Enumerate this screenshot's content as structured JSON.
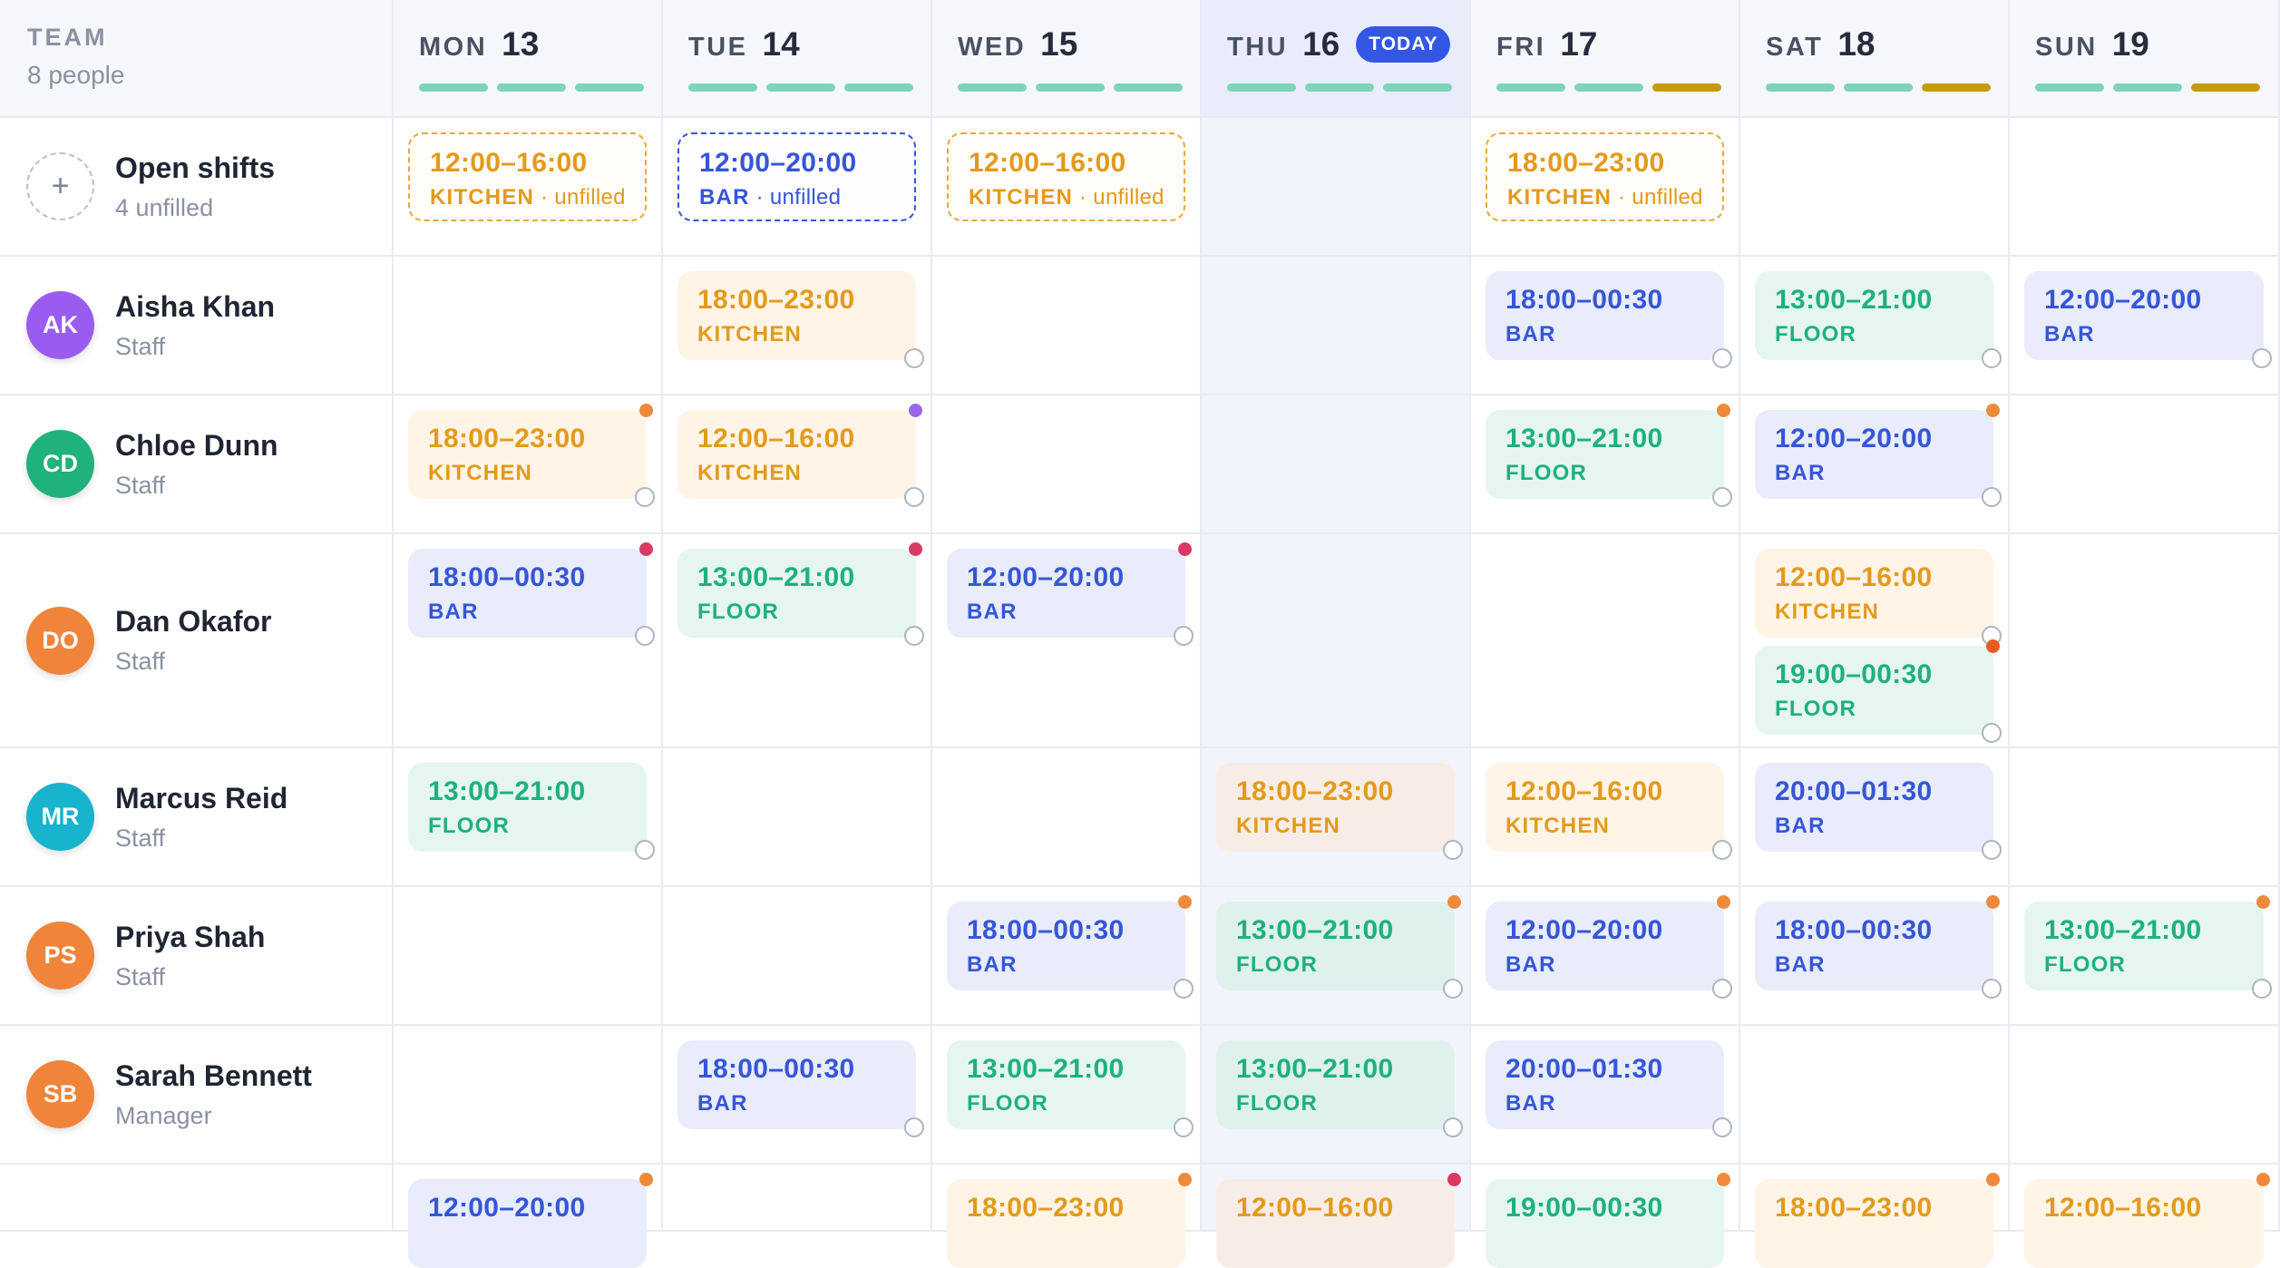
{
  "team": {
    "title": "TEAM",
    "count": "8 people"
  },
  "colors": {
    "kitchen": "#e39a1c",
    "bar": "#3656d6",
    "floor": "#1fb07f",
    "accent": "#3457e3",
    "coverage_ok": "#7fd4b8",
    "coverage_partial": "#c69a0f"
  },
  "days": [
    {
      "dow": "MON",
      "num": "13",
      "coverage": [
        "ok",
        "ok",
        "ok"
      ]
    },
    {
      "dow": "TUE",
      "num": "14",
      "coverage": [
        "ok",
        "ok",
        "ok"
      ]
    },
    {
      "dow": "WED",
      "num": "15",
      "coverage": [
        "ok",
        "ok",
        "ok"
      ]
    },
    {
      "dow": "THU",
      "num": "16",
      "coverage": [
        "ok",
        "ok",
        "ok"
      ],
      "today_label": "TODAY"
    },
    {
      "dow": "FRI",
      "num": "17",
      "coverage": [
        "ok",
        "ok",
        "partial"
      ]
    },
    {
      "dow": "SAT",
      "num": "18",
      "coverage": [
        "ok",
        "ok",
        "partial"
      ]
    },
    {
      "dow": "SUN",
      "num": "19",
      "coverage": [
        "ok",
        "ok",
        "partial"
      ]
    }
  ],
  "rows": [
    {
      "name": "Open shifts",
      "role": "4 unfilled",
      "avatar": "+",
      "open": true,
      "shifts": [
        [
          {
            "time": "12:00–16:00",
            "area": "KITCHEN",
            "sub": " · unfilled",
            "type": "open-kitchen"
          }
        ],
        [
          {
            "time": "12:00–20:00",
            "area": "BAR",
            "sub": " · unfilled",
            "type": "open-bar"
          }
        ],
        [
          {
            "time": "12:00–16:00",
            "area": "KITCHEN",
            "sub": " · unfilled",
            "type": "open-kitchen"
          }
        ],
        [],
        [
          {
            "time": "18:00–23:00",
            "area": "KITCHEN",
            "sub": " · unfilled",
            "type": "open-kitchen"
          }
        ],
        [],
        []
      ]
    },
    {
      "name": "Aisha Khan",
      "role": "Staff",
      "avatar": "AK",
      "avatar_color": "#9a5cf0",
      "shifts": [
        [],
        [
          {
            "time": "18:00–23:00",
            "area": "KITCHEN",
            "type": "kitchen",
            "ring": true
          }
        ],
        [],
        [],
        [
          {
            "time": "18:00–00:30",
            "area": "BAR",
            "type": "bar",
            "ring": true
          }
        ],
        [
          {
            "time": "13:00–21:00",
            "area": "FLOOR",
            "type": "floor",
            "ring": true
          }
        ],
        [
          {
            "time": "12:00–20:00",
            "area": "BAR",
            "type": "bar",
            "ring": true
          }
        ]
      ]
    },
    {
      "name": "Chloe Dunn",
      "role": "Staff",
      "avatar": "CD",
      "avatar_color": "#1fb27a",
      "shifts": [
        [
          {
            "time": "18:00–23:00",
            "area": "KITCHEN",
            "type": "kitchen",
            "ring": true,
            "flag": "#ef8a3c"
          }
        ],
        [
          {
            "time": "12:00–16:00",
            "area": "KITCHEN",
            "type": "kitchen",
            "ring": true,
            "flag": "#9a66e8"
          }
        ],
        [],
        [],
        [
          {
            "time": "13:00–21:00",
            "area": "FLOOR",
            "type": "floor",
            "ring": true,
            "flag": "#ef8a3c"
          }
        ],
        [
          {
            "time": "12:00–20:00",
            "area": "BAR",
            "type": "bar",
            "ring": true,
            "flag": "#ef8a3c"
          }
        ],
        []
      ]
    },
    {
      "name": "Dan Okafor",
      "role": "Staff",
      "avatar": "DO",
      "avatar_color": "#f0843a",
      "shifts": [
        [
          {
            "time": "18:00–00:30",
            "area": "BAR",
            "type": "bar",
            "ring": true,
            "flag": "#d93a63"
          }
        ],
        [
          {
            "time": "13:00–21:00",
            "area": "FLOOR",
            "type": "floor",
            "ring": true,
            "flag": "#d93a63"
          }
        ],
        [
          {
            "time": "12:00–20:00",
            "area": "BAR",
            "type": "bar",
            "ring": true,
            "flag": "#d93a63"
          }
        ],
        [],
        [],
        [
          {
            "time": "12:00–16:00",
            "area": "KITCHEN",
            "type": "kitchen",
            "ring": true
          },
          {
            "time": "19:00–00:30",
            "area": "FLOOR",
            "type": "floor",
            "ring": true,
            "flag": "#e85a20"
          }
        ],
        []
      ]
    },
    {
      "name": "Marcus Reid",
      "role": "Staff",
      "avatar": "MR",
      "avatar_color": "#18b3cc",
      "shifts": [
        [
          {
            "time": "13:00–21:00",
            "area": "FLOOR",
            "type": "floor",
            "ring": true
          }
        ],
        [],
        [],
        [
          {
            "time": "18:00–23:00",
            "area": "KITCHEN",
            "type": "kitchen",
            "ring": true
          }
        ],
        [
          {
            "time": "12:00–16:00",
            "area": "KITCHEN",
            "type": "kitchen",
            "ring": true
          }
        ],
        [
          {
            "time": "20:00–01:30",
            "area": "BAR",
            "type": "bar",
            "ring": true
          }
        ],
        []
      ]
    },
    {
      "name": "Priya Shah",
      "role": "Staff",
      "avatar": "PS",
      "avatar_color": "#f0843a",
      "shifts": [
        [],
        [],
        [
          {
            "time": "18:00–00:30",
            "area": "BAR",
            "type": "bar",
            "ring": true,
            "flag": "#ef8a3c"
          }
        ],
        [
          {
            "time": "13:00–21:00",
            "area": "FLOOR",
            "type": "floor",
            "ring": true,
            "flag": "#ef8a3c"
          }
        ],
        [
          {
            "time": "12:00–20:00",
            "area": "BAR",
            "type": "bar",
            "ring": true,
            "flag": "#ef8a3c"
          }
        ],
        [
          {
            "time": "18:00–00:30",
            "area": "BAR",
            "type": "bar",
            "ring": true,
            "flag": "#ef8a3c"
          }
        ],
        [
          {
            "time": "13:00–21:00",
            "area": "FLOOR",
            "type": "floor",
            "ring": true,
            "flag": "#ef8a3c"
          }
        ]
      ]
    },
    {
      "name": "Sarah Bennett",
      "role": "Manager",
      "avatar": "SB",
      "avatar_color": "#f0843a",
      "shifts": [
        [],
        [
          {
            "time": "18:00–00:30",
            "area": "BAR",
            "type": "bar",
            "ring": true
          }
        ],
        [
          {
            "time": "13:00–21:00",
            "area": "FLOOR",
            "type": "floor",
            "ring": true
          }
        ],
        [
          {
            "time": "13:00–21:00",
            "area": "FLOOR",
            "type": "floor",
            "ring": true
          }
        ],
        [
          {
            "time": "20:00–01:30",
            "area": "BAR",
            "type": "bar",
            "ring": true
          }
        ],
        [],
        []
      ]
    },
    {
      "name": "",
      "role": "",
      "avatar": "",
      "partial": true,
      "shifts": [
        [
          {
            "time": "12:00–20:00",
            "area": "",
            "type": "bar",
            "flag": "#ef8a3c"
          }
        ],
        [],
        [
          {
            "time": "18:00–23:00",
            "area": "",
            "type": "kitchen",
            "flag": "#ef8a3c"
          }
        ],
        [
          {
            "time": "12:00–16:00",
            "area": "",
            "type": "kitchen",
            "flag": "#d93a63"
          }
        ],
        [
          {
            "time": "19:00–00:30",
            "area": "",
            "type": "floor",
            "flag": "#ef8a3c"
          }
        ],
        [
          {
            "time": "18:00–23:00",
            "area": "",
            "type": "kitchen",
            "flag": "#ef8a3c"
          }
        ],
        [
          {
            "time": "12:00–16:00",
            "area": "",
            "type": "kitchen",
            "flag": "#ef8a3c"
          }
        ]
      ]
    }
  ]
}
